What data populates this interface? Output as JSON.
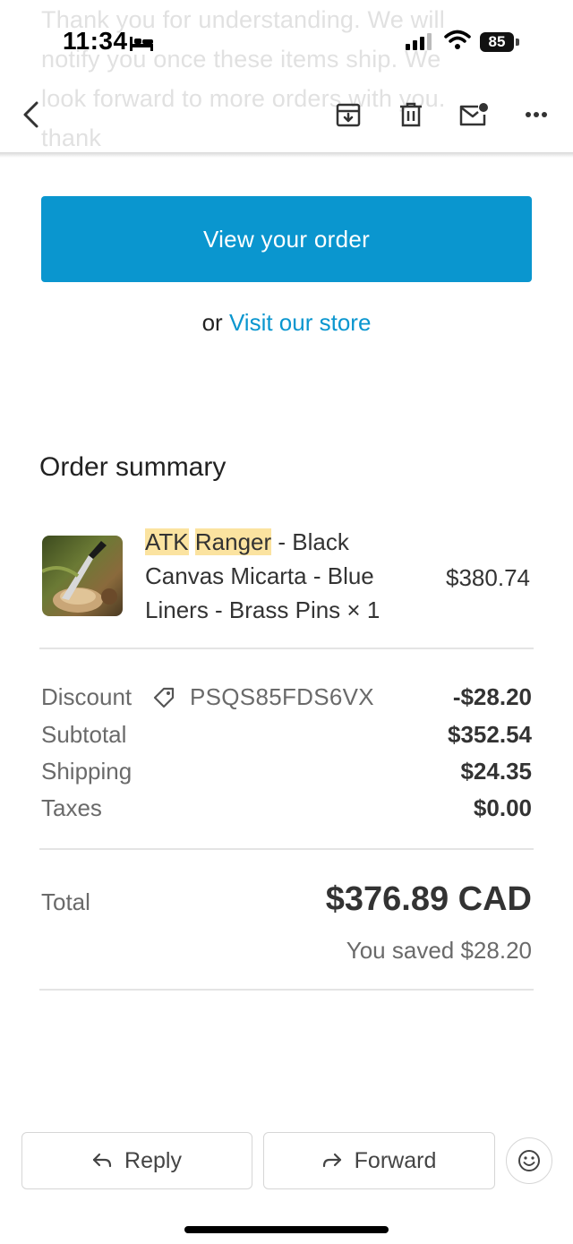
{
  "status_bar": {
    "time": "11:34",
    "battery": "85"
  },
  "background_text": "Thank you for understanding. We will\nnotify you once these items ship. We\nlook forward to more orders with you.\nthank",
  "toolbar": {
    "icons": [
      "back-icon",
      "archive-icon",
      "trash-icon",
      "mark-unread-icon",
      "more-icon"
    ]
  },
  "main": {
    "view_order_label": "View your order",
    "visit_prefix": "or",
    "visit_link": "Visit our store"
  },
  "order": {
    "title": "Order summary",
    "product": {
      "name_hl1": "ATK",
      "name_hl2": "Ranger",
      "name_rest": " - Black Canvas Micarta - Blue Liners - Brass Pins × 1",
      "price": "$380.74"
    },
    "discount_label": "Discount",
    "discount_code": "PSQS85FDS6VX",
    "discount_value": "-$28.20",
    "subtotal_label": "Subtotal",
    "subtotal_value": "$352.54",
    "shipping_label": "Shipping",
    "shipping_value": "$24.35",
    "taxes_label": "Taxes",
    "taxes_value": "$0.00",
    "total_label": "Total",
    "total_value": "$376.89 CAD",
    "saved_text": "You saved $28.20"
  },
  "actions": {
    "reply_label": "Reply",
    "forward_label": "Forward"
  },
  "colors": {
    "accent": "#0a96cf",
    "highlight": "#fbe3a0"
  }
}
